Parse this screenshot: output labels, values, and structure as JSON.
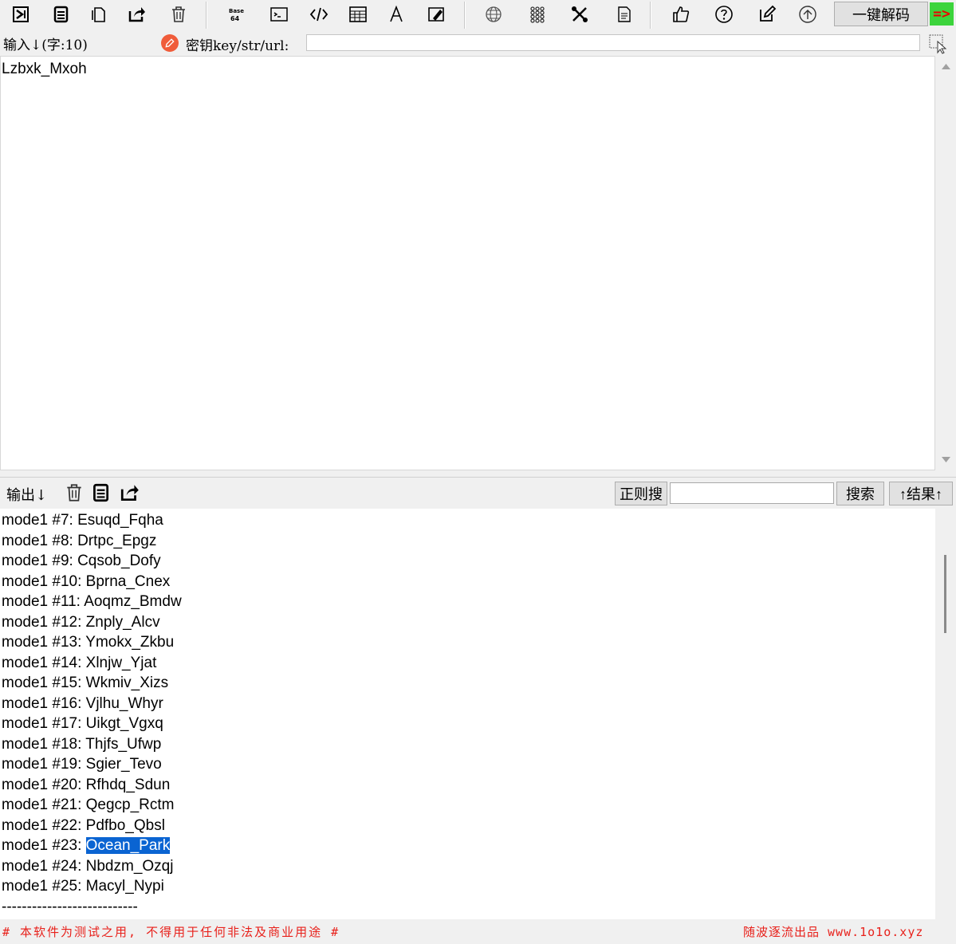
{
  "toolbar": {
    "decode_label": "一键解码",
    "badge": "=>",
    "icons": [
      "import-icon",
      "copy-icon",
      "paste-icon",
      "share-icon",
      "trash-icon",
      "base64-icon",
      "terminal-icon",
      "code-icon",
      "calculator-icon",
      "font-icon",
      "edit-board-icon",
      "globe-icon",
      "grid-icon",
      "tools-icon",
      "document-icon",
      "thumbs-up-icon",
      "help-icon",
      "edit-icon",
      "upload-icon"
    ]
  },
  "input": {
    "label": "输入↓(字:10)",
    "key_label": "密钥key/str/url:",
    "key_value": "",
    "text": "Lzbxk_Mxoh"
  },
  "output": {
    "label": "输出↓",
    "regex_label": "正则搜",
    "regex_value": "",
    "search_label": "搜索",
    "result_label": "↑结果↑",
    "lines": [
      {
        "prefix": "mode1 #7: ",
        "value": "Esuqd_Fqha"
      },
      {
        "prefix": "mode1 #8: ",
        "value": "Drtpc_Epgz"
      },
      {
        "prefix": "mode1 #9: ",
        "value": "Cqsob_Dofy"
      },
      {
        "prefix": "mode1 #10: ",
        "value": "Bprna_Cnex"
      },
      {
        "prefix": "mode1 #11: ",
        "value": "Aoqmz_Bmdw"
      },
      {
        "prefix": "mode1 #12: ",
        "value": "Znply_Alcv"
      },
      {
        "prefix": "mode1 #13: ",
        "value": "Ymokx_Zkbu"
      },
      {
        "prefix": "mode1 #14: ",
        "value": "Xlnjw_Yjat"
      },
      {
        "prefix": "mode1 #15: ",
        "value": "Wkmiv_Xizs"
      },
      {
        "prefix": "mode1 #16: ",
        "value": "Vjlhu_Whyr"
      },
      {
        "prefix": "mode1 #17: ",
        "value": "Uikgt_Vgxq"
      },
      {
        "prefix": "mode1 #18: ",
        "value": "Thjfs_Ufwp"
      },
      {
        "prefix": "mode1 #19: ",
        "value": "Sgier_Tevo"
      },
      {
        "prefix": "mode1 #20: ",
        "value": "Rfhdq_Sdun"
      },
      {
        "prefix": "mode1 #21: ",
        "value": "Qegcp_Rctm"
      },
      {
        "prefix": "mode1 #22: ",
        "value": "Pdfbo_Qbsl"
      },
      {
        "prefix": "mode1 #23: ",
        "value": "Ocean_Park",
        "selected": true
      },
      {
        "prefix": "mode1 #24: ",
        "value": "Nbdzm_Ozqj"
      },
      {
        "prefix": "mode1 #25: ",
        "value": "Macyl_Nypi"
      }
    ],
    "divider": "---------------------------"
  },
  "footer": {
    "left": "# 本软件为测试之用, 不得用于任何非法及商业用途 #",
    "right": "随波逐流出品 www.1o1o.xyz"
  }
}
